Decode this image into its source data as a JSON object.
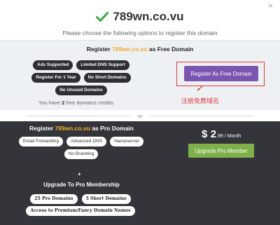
{
  "header": {
    "domain": "789wn.co.vu",
    "subtitle": "Please choose the following options to register this domain",
    "close_glyph": "×"
  },
  "free": {
    "heading_prefix": "Register",
    "heading_domain": "789wn.co.vu",
    "heading_suffix": "as Free Domain",
    "features_row1": [
      "Ads Supported",
      "Limited DNS Support"
    ],
    "features_row2": [
      "Register For 1 Year",
      "No Short Domains"
    ],
    "features_row3": [
      "No Unused Domains"
    ],
    "credits_prefix": "You have",
    "credits_count": "2",
    "credits_suffix": "free domains credits",
    "button_label": "Register As Free Domain",
    "annotation": "注册免费域名"
  },
  "divider": {
    "label": "or"
  },
  "pro": {
    "heading_prefix": "Register",
    "heading_domain": "789wn.co.vu",
    "heading_suffix": "as Pro Domain",
    "features_row1": [
      "Email Forwarding",
      "Advanced DNS",
      "Nameserver"
    ],
    "features_row2": [
      "No Branding"
    ],
    "price_currency": "$",
    "price_amount": "2",
    "price_cents": ".99 / Month",
    "button_label": "Upgrade Pro Member",
    "plus": "+",
    "upgrade_heading": "Upgrade To Pro Membership",
    "membership_row1": [
      "25 Pro Domains",
      "5 Short Domains"
    ],
    "membership_row2": [
      "Access to Premium/Fancy Domain Names"
    ]
  },
  "colors": {
    "accent_purple": "#7a56b0",
    "accent_green": "#7fb14a",
    "domain_orange": "#f0ad2c",
    "annotation_red": "#e23b3b",
    "dark_panel": "#34353a"
  }
}
